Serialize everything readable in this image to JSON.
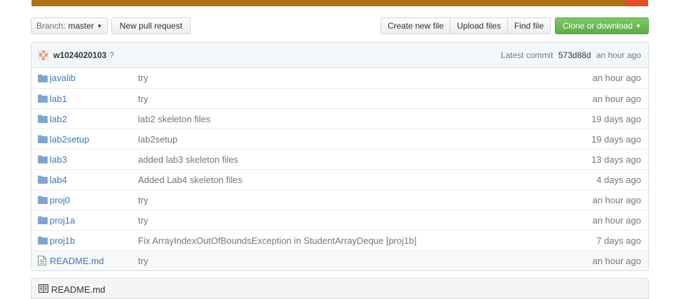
{
  "language_bar": {
    "colors": [
      "#b07219",
      "#e34c26"
    ],
    "fractions": [
      0.963,
      0.037
    ]
  },
  "toolbar": {
    "branch_prefix": "Branch:",
    "branch_name": "master",
    "pull_request_label": "New pull request",
    "create_file_label": "Create new file",
    "upload_files_label": "Upload files",
    "find_file_label": "Find file",
    "clone_label": "Clone or download"
  },
  "commit": {
    "author": "w1024020103",
    "toggle": "?",
    "latest_label": "Latest commit",
    "sha": "573d88d",
    "age": "an hour ago"
  },
  "files": [
    {
      "type": "directory",
      "icon": "folder-icon",
      "name": "javalib",
      "message": "try",
      "age": "an hour ago"
    },
    {
      "type": "directory",
      "icon": "folder-icon",
      "name": "lab1",
      "message": "try",
      "age": "an hour ago"
    },
    {
      "type": "directory",
      "icon": "folder-icon",
      "name": "lab2",
      "message": "lab2 skeleton files",
      "age": "19 days ago"
    },
    {
      "type": "directory",
      "icon": "folder-icon",
      "name": "lab2setup",
      "message": "lab2setup",
      "age": "19 days ago"
    },
    {
      "type": "directory",
      "icon": "folder-icon",
      "name": "lab3",
      "message": "added lab3 skeleton files",
      "age": "13 days ago"
    },
    {
      "type": "directory",
      "icon": "folder-icon",
      "name": "lab4",
      "message": "Added Lab4 skeleton files",
      "age": "4 days ago"
    },
    {
      "type": "directory",
      "icon": "folder-icon",
      "name": "proj0",
      "message": "try",
      "age": "an hour ago"
    },
    {
      "type": "directory",
      "icon": "folder-icon",
      "name": "proj1a",
      "message": "try",
      "age": "an hour ago"
    },
    {
      "type": "directory",
      "icon": "folder-icon",
      "name": "proj1b",
      "message": "Fix ArrayIndexOutOfBoundsException in StudentArrayDeque [proj1b]",
      "age": "7 days ago"
    },
    {
      "type": "file",
      "icon": "file-icon",
      "name": "README.md",
      "message": "try",
      "age": "an hour ago"
    }
  ],
  "readme": {
    "title": "README.md",
    "icon": "book-icon"
  }
}
